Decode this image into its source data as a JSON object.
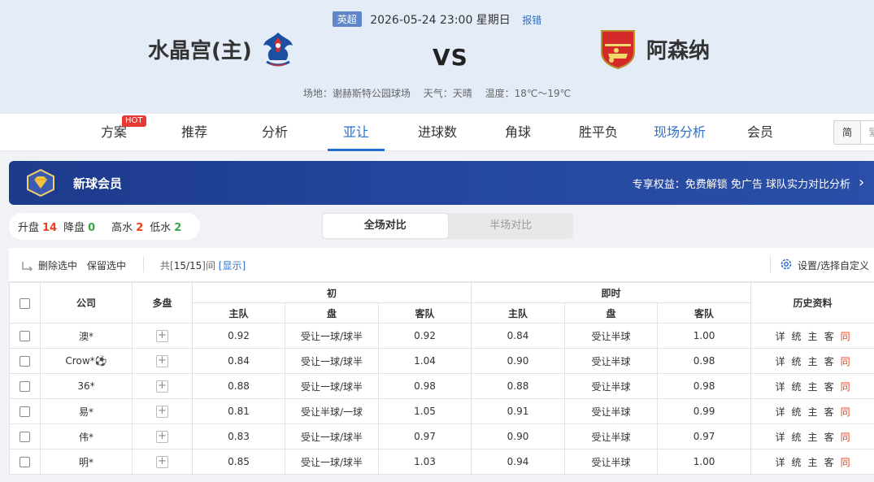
{
  "match": {
    "league": "英超",
    "datetime": "2026-05-24 23:00 星期日",
    "report": "报错",
    "home": "水晶宫(主)",
    "vs": "VS",
    "away": "阿森纳",
    "venue": "场地：谢赫斯特公园球场",
    "weather": "天气：天晴",
    "temperature": "温度：18℃～19℃"
  },
  "nav": {
    "items": [
      "方案",
      "推荐",
      "分析",
      "亚让",
      "进球数",
      "角球",
      "胜平负",
      "现场分析",
      "会员"
    ],
    "active_index": 3,
    "hot_badge": "HOT",
    "lang": [
      "简",
      "繁"
    ]
  },
  "vip": {
    "title": "新球会员",
    "benefits": "专享权益：免费解锁 免广告 球队实力对比分析"
  },
  "stats": {
    "up_label": "升盘",
    "up_value": "14",
    "down_label": "降盘",
    "down_value": "0",
    "high_label": "高水",
    "high_value": "2",
    "low_label": "低水",
    "low_value": "2"
  },
  "compare_tabs": [
    "全场对比",
    "半场对比"
  ],
  "toolbar": {
    "delete_selected": "删除选中",
    "keep_selected": "保留选中",
    "total_prefix": "共[",
    "total_count": "15/15",
    "total_suffix": "]间",
    "show_link": "[显示]",
    "settings": "设置/选择自定义"
  },
  "table": {
    "headers": {
      "company": "公司",
      "multi": "多盘",
      "initial": "初",
      "live": "即时",
      "history": "历史资料",
      "home": "主队",
      "line": "盘",
      "away": "客队"
    },
    "history_links": [
      "详",
      "统",
      "主",
      "客",
      "同"
    ],
    "rows": [
      {
        "company": "澳*",
        "init_home": "0.92",
        "init_line": "受让一球/球半",
        "init_away": "0.92",
        "live_home": "0.84",
        "live_line": "受让半球",
        "live_away": "1.00"
      },
      {
        "company": "Crow*⚽",
        "init_home": "0.84",
        "init_line": "受让一球/球半",
        "init_away": "1.04",
        "live_home": "0.90",
        "live_line": "受让半球",
        "live_away": "0.98"
      },
      {
        "company": "36*",
        "init_home": "0.88",
        "init_line": "受让一球/球半",
        "init_away": "0.98",
        "live_home": "0.88",
        "live_line": "受让半球",
        "live_away": "0.98"
      },
      {
        "company": "易*",
        "init_home": "0.81",
        "init_line": "受让半球/一球",
        "init_away": "1.05",
        "live_home": "0.91",
        "live_line": "受让半球",
        "live_away": "0.99"
      },
      {
        "company": "伟*",
        "init_home": "0.83",
        "init_line": "受让一球/球半",
        "init_away": "0.97",
        "live_home": "0.90",
        "live_line": "受让半球",
        "live_away": "0.97"
      },
      {
        "company": "明*",
        "init_home": "0.85",
        "init_line": "受让一球/球半",
        "init_away": "1.03",
        "live_home": "0.94",
        "live_line": "受让半球",
        "live_away": "1.00"
      }
    ]
  },
  "colors": {
    "accent_blue": "#1f6fd6",
    "banner_blue": "#25489f",
    "up_red": "#e8411c",
    "down_green": "#3aa54b"
  }
}
